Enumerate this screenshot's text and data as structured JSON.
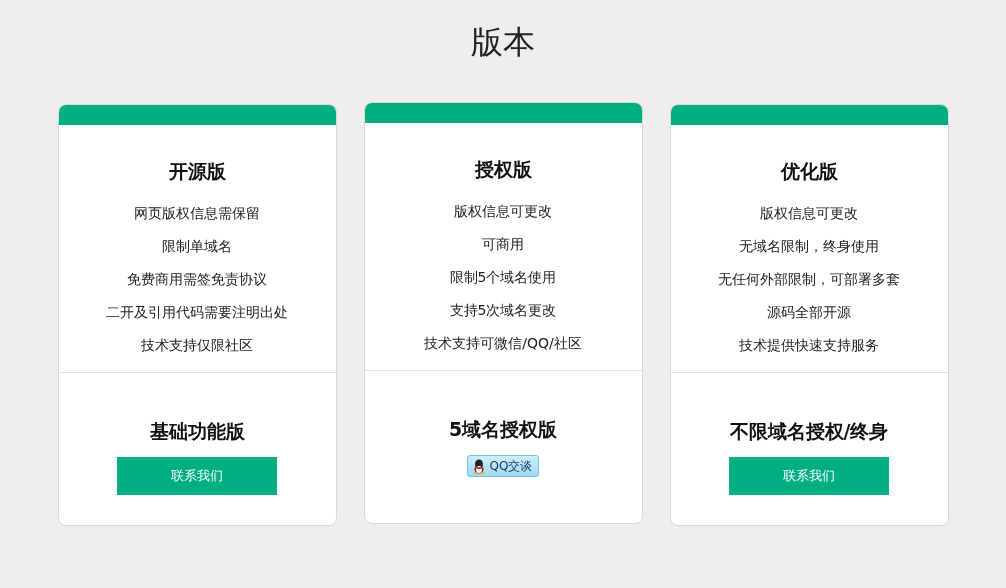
{
  "title": "版本",
  "plans": [
    {
      "name": "开源版",
      "features": [
        "网页版权信息需保留",
        "限制单域名",
        "免费商用需签免责协议",
        "二开及引用代码需要注明出处",
        "技术支持仅限社区"
      ],
      "tier": "基础功能版",
      "action": {
        "kind": "primary",
        "label": "联系我们"
      }
    },
    {
      "name": "授权版",
      "features": [
        "版权信息可更改",
        "可商用",
        "限制5个域名使用",
        "支持5次域名更改",
        "技术支持可微信/QQ/社区"
      ],
      "tier": "5域名授权版",
      "action": {
        "kind": "qq",
        "label": "QQ交谈"
      }
    },
    {
      "name": "优化版",
      "features": [
        "版权信息可更改",
        "无域名限制，终身使用",
        "无任何外部限制，可部署多套",
        "源码全部开源",
        "技术提供快速支持服务"
      ],
      "tier": "不限域名授权/终身",
      "action": {
        "kind": "primary",
        "label": "联系我们"
      }
    }
  ]
}
